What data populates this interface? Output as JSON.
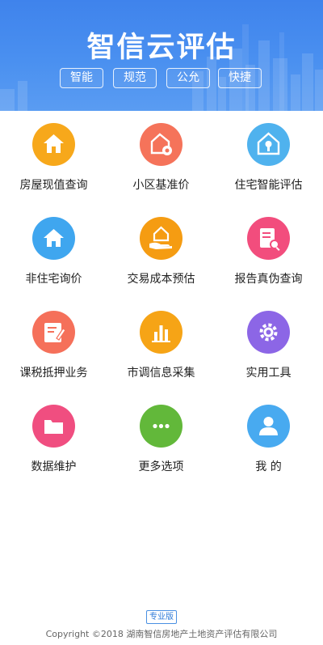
{
  "header": {
    "title": "智信云评估",
    "tags": [
      "智能",
      "规范",
      "公允",
      "快捷"
    ]
  },
  "menu": [
    {
      "label": "房屋现值查询",
      "icon": "house-icon",
      "color": "#f7a81b"
    },
    {
      "label": "小区基准价",
      "icon": "house-coin-icon",
      "color": "#f5735a"
    },
    {
      "label": "住宅智能评估",
      "icon": "smart-house-icon",
      "color": "#4fb2ee"
    },
    {
      "label": "非住宅询价",
      "icon": "building-icon",
      "color": "#3fa6ef"
    },
    {
      "label": "交易成本预估",
      "icon": "hand-house-icon",
      "color": "#f59c12"
    },
    {
      "label": "报告真伪查询",
      "icon": "report-search-icon",
      "color": "#f24d7d"
    },
    {
      "label": "课税抵押业务",
      "icon": "tax-document-icon",
      "color": "#f5705a"
    },
    {
      "label": "市调信息采集",
      "icon": "bar-chart-icon",
      "color": "#f6a416"
    },
    {
      "label": "实用工具",
      "icon": "gear-icon",
      "color": "#8c66e6"
    },
    {
      "label": "数据维护",
      "icon": "folder-icon",
      "color": "#f04e80"
    },
    {
      "label": "更多选项",
      "icon": "more-dots-icon",
      "color": "#62b83a"
    },
    {
      "label": "我 的",
      "icon": "user-icon",
      "color": "#48aaf0"
    }
  ],
  "footer": {
    "edition": "专业版",
    "copyright": "Copyright ©2018 湖南智信房地产土地资产评估有限公司"
  }
}
